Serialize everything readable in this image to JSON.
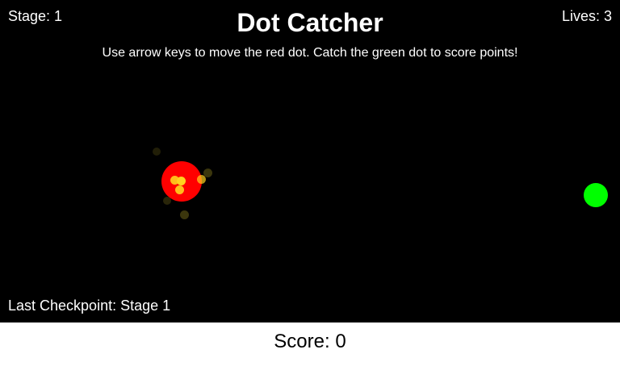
{
  "hud": {
    "stage_label": "Stage: 1",
    "lives_label": "Lives: 3",
    "title": "Dot Catcher",
    "instructions": "Use arrow keys to move the red dot. Catch the green dot to score points!",
    "checkpoint_label": "Last Checkpoint: Stage 1"
  },
  "score": {
    "label": "Score: 0"
  },
  "colors": {
    "canvas_background": "#000000",
    "player": "#ff0000",
    "target": "#00ff00",
    "particle_bright": "#ffd21e",
    "particle_dim": "#4a4310",
    "text_on_canvas": "#ffffff",
    "score_text": "#000000"
  }
}
